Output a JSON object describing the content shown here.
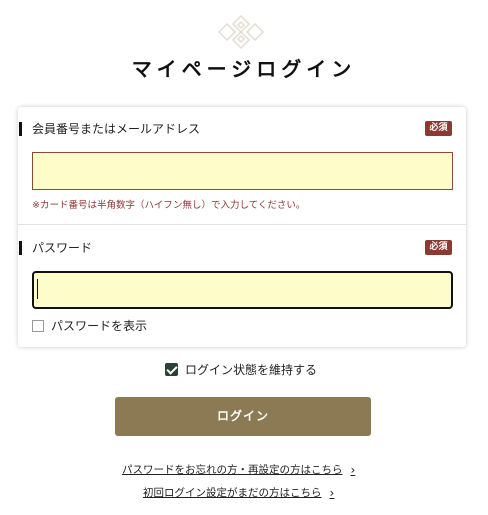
{
  "header": {
    "title": "マイページログイン"
  },
  "email_field": {
    "label": "会員番号またはメールアドレス",
    "required_badge": "必須",
    "value": "",
    "note": "※カード番号は半角数字（ハイフン無し）で入力してください。"
  },
  "password_field": {
    "label": "パスワード",
    "required_badge": "必須",
    "value": "",
    "show_password_label": "パスワードを表示",
    "show_password_checked": false
  },
  "keep_login": {
    "label": "ログイン状態を維持する",
    "checked": true
  },
  "login_button": {
    "label": "ログイン"
  },
  "links": {
    "forgot_password": "パスワードをお忘れの方・再設定の方はこちら",
    "first_login": "初回ログイン設定がまだの方はこちら"
  },
  "colors": {
    "required_badge": "#8b3a33",
    "input_bg": "#fefcc8",
    "button_bg": "#8b7a54",
    "checkbox_checked": "#2a4236"
  },
  "icons": {
    "logo": "diamond-lattice-logo-icon",
    "chevron": "chevron-right-icon"
  }
}
